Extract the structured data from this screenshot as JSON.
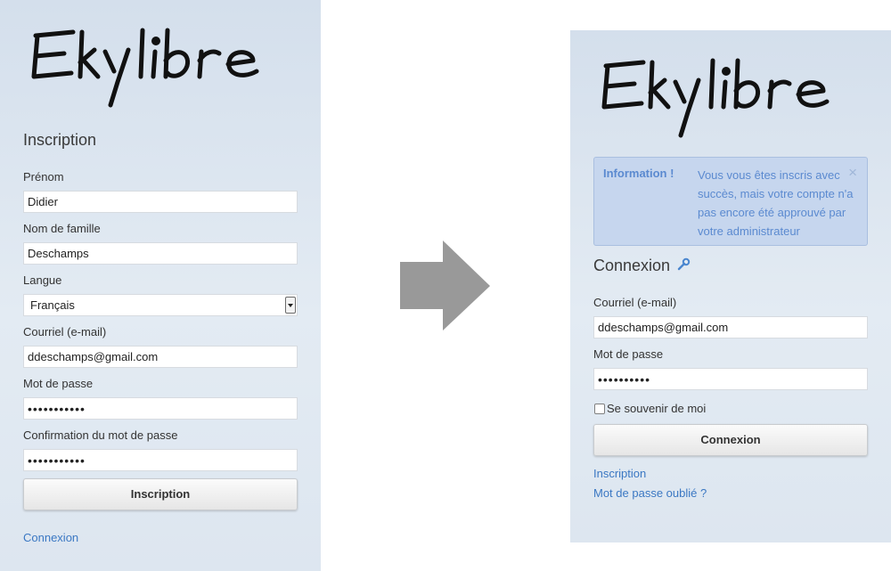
{
  "brand": {
    "logo_text": "Ekylibre"
  },
  "signup": {
    "heading": "Inscription",
    "fields": [
      {
        "label": "Prénom",
        "value": "Didier"
      },
      {
        "label": "Nom de famille",
        "value": "Deschamps"
      },
      {
        "label": "Langue",
        "value": "Français"
      },
      {
        "label": "Courriel (e-mail)",
        "value": "ddeschamps@gmail.com"
      },
      {
        "label": "Mot de passe",
        "value": "•••••••••••"
      },
      {
        "label": "Confirmation du mot de passe",
        "value": "•••••••••••"
      }
    ],
    "submit_label": "Inscription",
    "login_link": "Connexion"
  },
  "transition": {
    "arrow_icon": "right-arrow-icon",
    "arrow_color": "#999999"
  },
  "login": {
    "alert": {
      "title": "Information !",
      "message": "Vous vous êtes inscris avec succès, mais votre compte n'a pas encore été approuvé par votre administrateur",
      "close": "×"
    },
    "heading": "Connexion",
    "heading_icon": "wrench-icon",
    "email_label": "Courriel (e-mail)",
    "email_value": "ddeschamps@gmail.com",
    "password_label": "Mot de passe",
    "password_value": "••••••••••",
    "remember_label": "Se souvenir de moi",
    "submit_label": "Connexion",
    "signup_link": "Inscription",
    "forgot_link": "Mot de passe oublié ?"
  },
  "colors": {
    "link": "#3b78c3",
    "alert_bg": "#c6d6ee",
    "alert_text": "#5b8ad0"
  }
}
